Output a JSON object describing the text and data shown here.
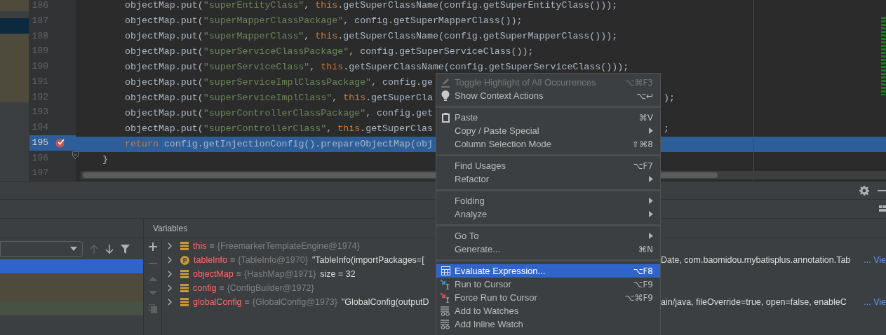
{
  "editor": {
    "lines": [
      {
        "number": "186",
        "kind": "statement",
        "current": false,
        "tokens": [
          {
            "t": "objectMap.put(",
            "kind": "plain"
          },
          {
            "t": "\"superEntityClass\"",
            "kind": "string"
          },
          {
            "t": ", ",
            "kind": "plain"
          },
          {
            "t": "this",
            "kind": "keyword"
          },
          {
            "t": ".getSuperClassName(config.getSuperEntityClass()));",
            "kind": "plain"
          }
        ]
      },
      {
        "number": "187",
        "kind": "statement",
        "current": false,
        "tokens": [
          {
            "t": "objectMap.put(",
            "kind": "plain"
          },
          {
            "t": "\"superMapperClassPackage\"",
            "kind": "string"
          },
          {
            "t": ", config.getSuperMapperClass());",
            "kind": "plain"
          }
        ]
      },
      {
        "number": "188",
        "kind": "statement",
        "current": false,
        "tokens": [
          {
            "t": "objectMap.put(",
            "kind": "plain"
          },
          {
            "t": "\"superMapperClass\"",
            "kind": "string"
          },
          {
            "t": ", ",
            "kind": "plain"
          },
          {
            "t": "this",
            "kind": "keyword"
          },
          {
            "t": ".getSuperClassName(config.getSuperMapperClass()));",
            "kind": "plain"
          }
        ]
      },
      {
        "number": "189",
        "kind": "statement",
        "current": false,
        "tokens": [
          {
            "t": "objectMap.put(",
            "kind": "plain"
          },
          {
            "t": "\"superServiceClassPackage\"",
            "kind": "string"
          },
          {
            "t": ", config.getSuperServiceClass());",
            "kind": "plain"
          }
        ]
      },
      {
        "number": "190",
        "kind": "statement",
        "current": false,
        "tokens": [
          {
            "t": "objectMap.put(",
            "kind": "plain"
          },
          {
            "t": "\"superServiceClass\"",
            "kind": "string"
          },
          {
            "t": ", ",
            "kind": "plain"
          },
          {
            "t": "this",
            "kind": "keyword"
          },
          {
            "t": ".getSuperClassName(config.getSuperServiceClass()));",
            "kind": "plain"
          }
        ]
      },
      {
        "number": "191",
        "kind": "statement",
        "current": false,
        "tokens": [
          {
            "t": "objectMap.put(",
            "kind": "plain"
          },
          {
            "t": "\"superServiceImplClassPackage\"",
            "kind": "string"
          },
          {
            "t": ", config.ge",
            "kind": "plain"
          }
        ]
      },
      {
        "number": "192",
        "kind": "statement",
        "current": false,
        "tokens": [
          {
            "t": "objectMap.put(",
            "kind": "plain"
          },
          {
            "t": "\"superServiceImplClass\"",
            "kind": "string"
          },
          {
            "t": ", ",
            "kind": "plain"
          },
          {
            "t": "this",
            "kind": "keyword"
          },
          {
            "t": ".getSuperCla",
            "kind": "plain"
          }
        ],
        "tail": ");"
      },
      {
        "number": "193",
        "kind": "statement",
        "current": false,
        "tokens": [
          {
            "t": "objectMap.put(",
            "kind": "plain"
          },
          {
            "t": "\"superControllerClassPackage\"",
            "kind": "string"
          },
          {
            "t": ", config.get",
            "kind": "plain"
          }
        ]
      },
      {
        "number": "194",
        "kind": "statement",
        "current": false,
        "tokens": [
          {
            "t": "objectMap.put(",
            "kind": "plain"
          },
          {
            "t": "\"superControllerClass\"",
            "kind": "string"
          },
          {
            "t": ", ",
            "kind": "plain"
          },
          {
            "t": "this",
            "kind": "keyword"
          },
          {
            "t": ".getSuperClas",
            "kind": "plain"
          }
        ],
        "tail": ";"
      },
      {
        "number": "195",
        "kind": "statement",
        "current": true,
        "breakpoint": true,
        "tokens": [
          {
            "t": "return",
            "kind": "keyword"
          },
          {
            "t": " config.getInjectionConfig().prepareObjectMap(obj",
            "kind": "plain"
          }
        ]
      },
      {
        "number": "196",
        "kind": "brace",
        "current": false,
        "fold": true,
        "tokens": [
          {
            "t": "}",
            "kind": "plain"
          }
        ]
      },
      {
        "number": "197",
        "kind": "blank",
        "current": false
      }
    ]
  },
  "debugger": {
    "frames": [
      {
        "selected": true
      },
      {
        "selected": false
      },
      {
        "selected": false
      },
      {
        "selected": false
      }
    ],
    "variables_title": "Variables",
    "variables": [
      {
        "kind": "field",
        "name": "this",
        "equals": "=",
        "type": "{FreemarkerTemplateEngine@1974}"
      },
      {
        "kind": "param",
        "name": "tableInfo",
        "equals": "=",
        "type": "{TableInfo@1970}",
        "value": "\"TableInfo(importPackages=[",
        "tail": "Date, com.baomidou.mybatisplus.annotation.Tab",
        "link": "... Vie"
      },
      {
        "kind": "field",
        "name": "objectMap",
        "equals": "=",
        "type": "{HashMap@1971}",
        "value": "size = 32"
      },
      {
        "kind": "field",
        "name": "config",
        "equals": "=",
        "type": "{ConfigBuilder@1972}"
      },
      {
        "kind": "field",
        "name": "globalConfig",
        "equals": "=",
        "type": "{GlobalConfig@1973}",
        "value": "\"GlobalConfig(outputD",
        "tail": "ain/java, fileOverride=true, open=false, enableC",
        "link": "... Vie"
      }
    ]
  },
  "context_menu": {
    "items": [
      {
        "kind": "item",
        "label": "Toggle Highlight of All Occurrences",
        "shortcut": "⌥⌘F3",
        "disabled": true,
        "selected": false
      },
      {
        "kind": "item",
        "label": "Show Context Actions",
        "shortcut": "⌥↩",
        "disabled": false,
        "selected": false
      },
      {
        "kind": "separator"
      },
      {
        "kind": "item",
        "label": "Paste",
        "shortcut": "⌘V",
        "disabled": false,
        "selected": false
      },
      {
        "kind": "item",
        "label": "Copy / Paste Special",
        "submenu": true,
        "disabled": false,
        "selected": false
      },
      {
        "kind": "item",
        "label": "Column Selection Mode",
        "shortcut": "⇧⌘8",
        "disabled": false,
        "selected": false
      },
      {
        "kind": "separator"
      },
      {
        "kind": "item",
        "label": "Find Usages",
        "shortcut": "⌥F7",
        "disabled": false,
        "selected": false
      },
      {
        "kind": "item",
        "label": "Refactor",
        "submenu": true,
        "disabled": false,
        "selected": false
      },
      {
        "kind": "separator"
      },
      {
        "kind": "item",
        "label": "Folding",
        "submenu": true,
        "disabled": false,
        "selected": false
      },
      {
        "kind": "item",
        "label": "Analyze",
        "submenu": true,
        "disabled": false,
        "selected": false
      },
      {
        "kind": "separator"
      },
      {
        "kind": "item",
        "label": "Go To",
        "submenu": true,
        "disabled": false,
        "selected": false
      },
      {
        "kind": "item",
        "label": "Generate...",
        "shortcut": "⌘N",
        "disabled": false,
        "selected": false
      },
      {
        "kind": "separator"
      },
      {
        "kind": "item",
        "label": "Evaluate Expression...",
        "shortcut": "⌥F8",
        "disabled": false,
        "selected": true
      },
      {
        "kind": "item",
        "label": "Run to Cursor",
        "shortcut": "⌥F9",
        "disabled": false,
        "selected": false
      },
      {
        "kind": "item",
        "label": "Force Run to Cursor",
        "shortcut": "⌥⌘F9",
        "disabled": false,
        "selected": false
      },
      {
        "kind": "item",
        "label": "Add to Watches",
        "disabled": false,
        "selected": false
      },
      {
        "kind": "item",
        "label": "Add Inline Watch",
        "disabled": false,
        "selected": false
      }
    ]
  }
}
